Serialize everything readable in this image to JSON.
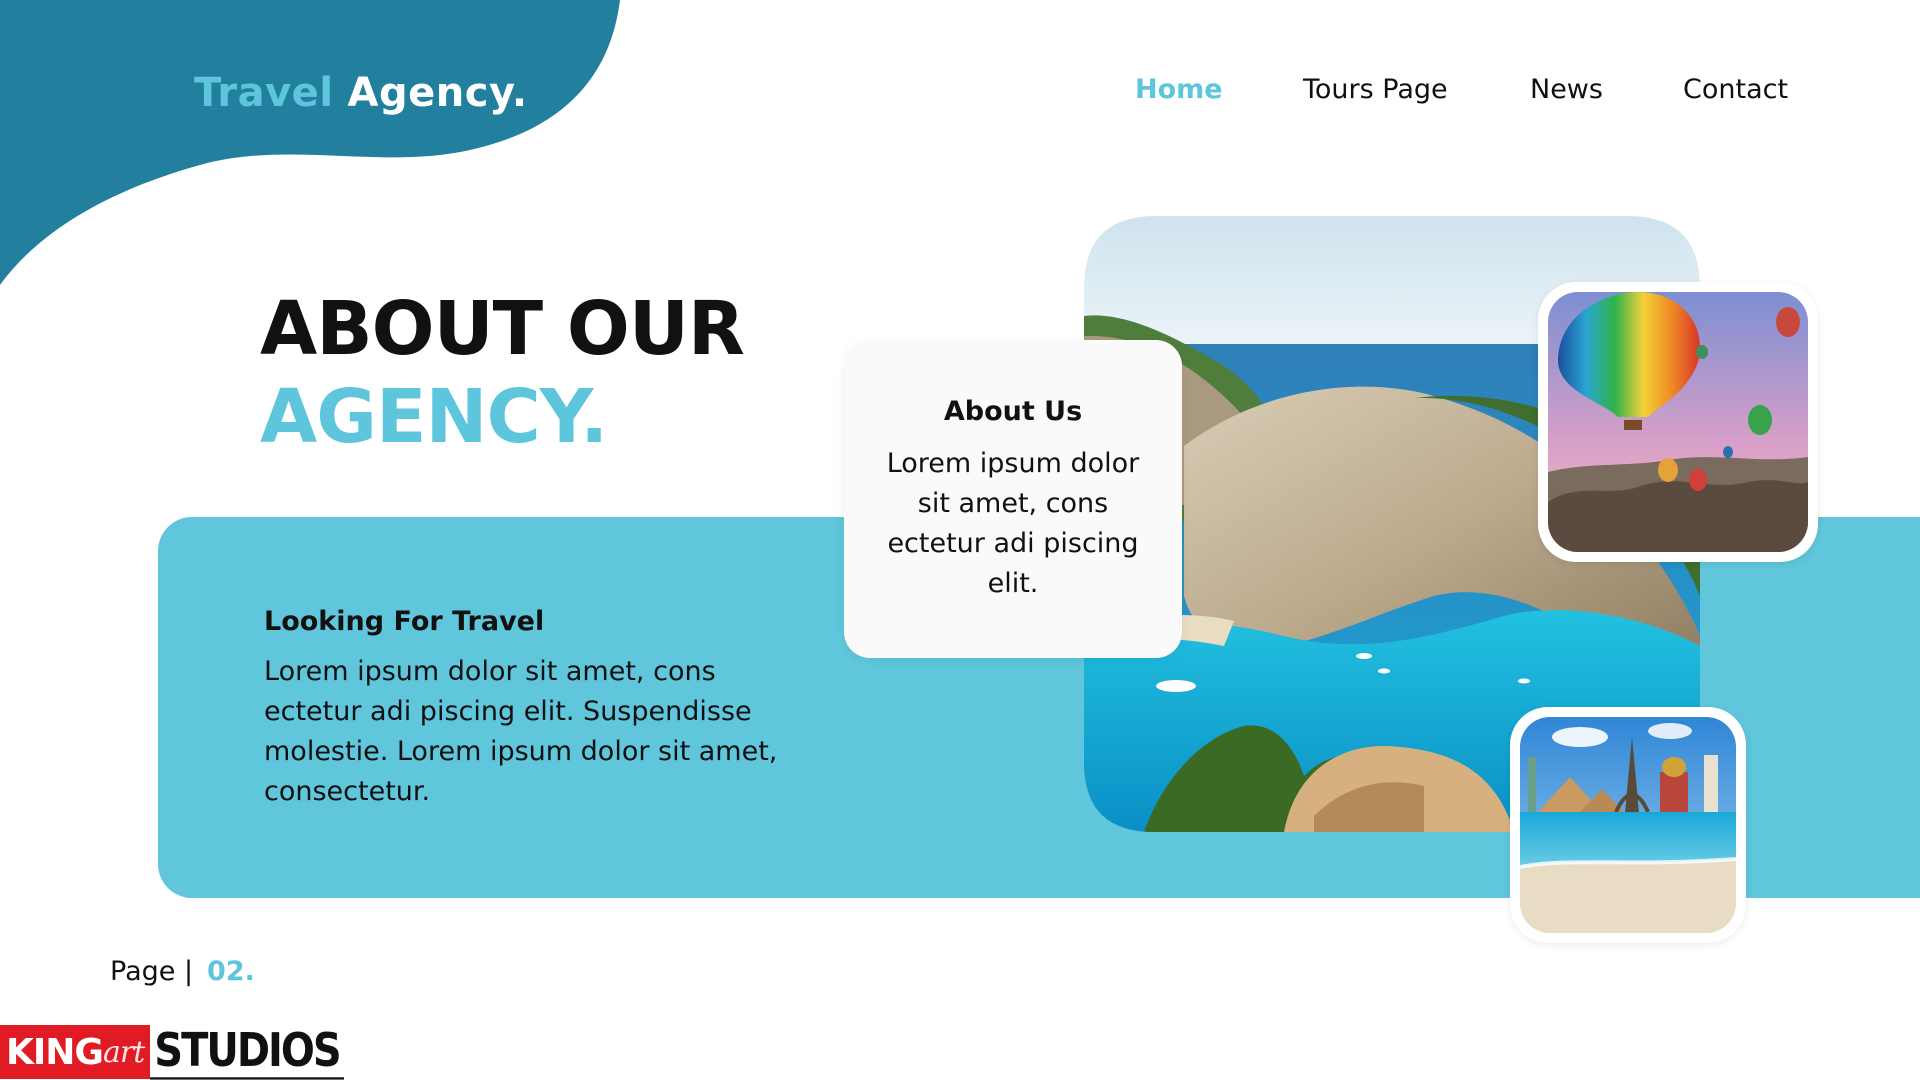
{
  "brand": {
    "word1": "Travel",
    "word2": "Agency."
  },
  "nav": {
    "home": "Home",
    "tours": "Tours Page",
    "news": "News",
    "contact": "Contact",
    "active": "Home"
  },
  "hero": {
    "line1": "ABOUT OUR",
    "line2": "AGENCY."
  },
  "band": {
    "heading": "Looking For Travel",
    "body": "Lorem ipsum dolor sit amet, cons ectetur adi piscing elit. Suspendisse molestie. Lorem ipsum dolor sit amet, consectetur."
  },
  "card": {
    "heading": "About Us",
    "body": "Lorem ipsum dolor sit amet, cons ectetur adi piscing elit."
  },
  "footer": {
    "page_label": "Page |",
    "page_number": "02."
  },
  "logo": {
    "king": "KING",
    "art": "art",
    "studios": "STUDIOS"
  },
  "colors": {
    "accent": "#5ec6dc",
    "dark_teal": "#227f9e",
    "band": "#5fc6dc",
    "text": "#111111"
  }
}
